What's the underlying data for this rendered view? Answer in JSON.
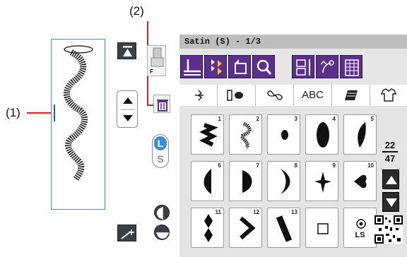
{
  "callouts": {
    "label_1": "(1)",
    "label_2": "(2)"
  },
  "screen": {
    "title": "Satin (S) - 1/3",
    "tabs": [
      "",
      "",
      "",
      "ABC",
      "",
      ""
    ],
    "page": {
      "current": "22",
      "total": "47"
    }
  },
  "controls": {
    "presser_foot_letter": "F",
    "mode_l": "L",
    "mode_s": "S",
    "qr_code_icon": "qr-code-icon"
  },
  "patterns": [
    {
      "num": "1",
      "icon": "zigzag-satin-icon"
    },
    {
      "num": "2",
      "icon": "wave-satin-icon"
    },
    {
      "num": "3",
      "icon": "dot-satin-icon"
    },
    {
      "num": "4",
      "icon": "leaf-satin-icon"
    },
    {
      "num": "5",
      "icon": "feather-satin-icon"
    },
    {
      "num": "6",
      "icon": "half-leaf-satin-icon"
    },
    {
      "num": "7",
      "icon": "d-shape-satin-icon"
    },
    {
      "num": "8",
      "icon": "crescent-satin-icon"
    },
    {
      "num": "9",
      "icon": "star-satin-icon"
    },
    {
      "num": "10",
      "icon": "arrow-satin-icon"
    },
    {
      "num": "11",
      "icon": "diamond-column-satin-icon"
    },
    {
      "num": "12",
      "icon": "chevron-satin-icon"
    },
    {
      "num": "13",
      "icon": "diagonal-bar-satin-icon"
    },
    {
      "num": "",
      "icon": "empty-square-icon"
    },
    {
      "num": "",
      "icon": "ls-stitch-icon",
      "label": "LS"
    }
  ],
  "accent_colors": {
    "toolbar": "#5b2f8c",
    "callout": "#d61f2a",
    "mode": "#3a8fd6"
  }
}
